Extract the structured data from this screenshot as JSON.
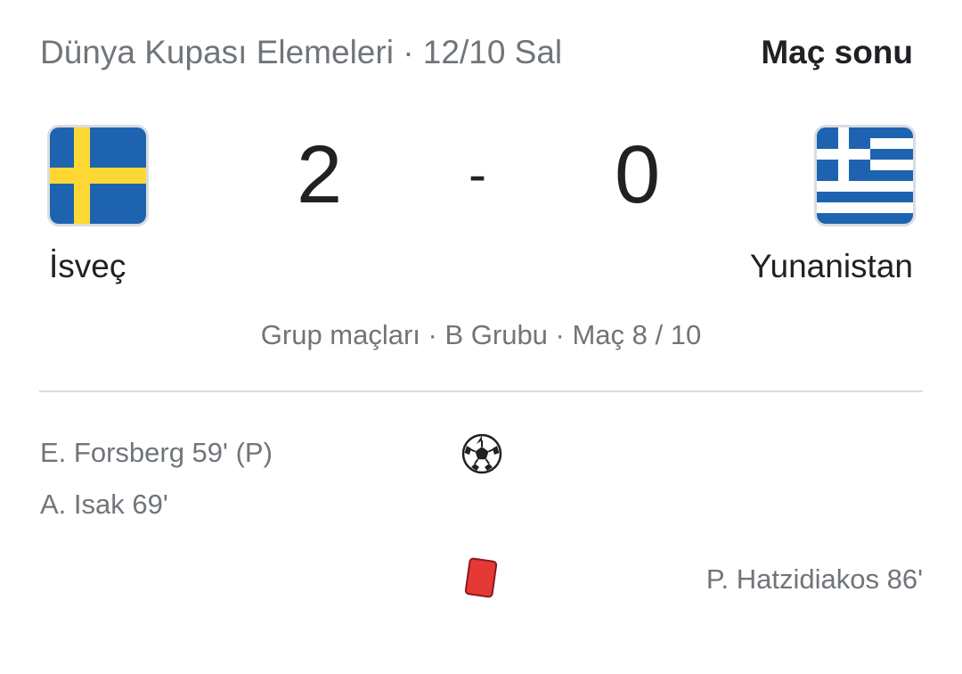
{
  "header": {
    "competition": "Dünya Kupası Elemeleri · 12/10 Sal",
    "status": "Maç sonu"
  },
  "match": {
    "home": {
      "name": "İsveç",
      "score": "2",
      "flag_icon": "sweden-flag-icon",
      "flag_colors": {
        "blue": "#1565c0",
        "yellow": "#fdd835"
      }
    },
    "away": {
      "name": "Yunanistan",
      "score": "0",
      "flag_icon": "greece-flag-icon",
      "flag_colors": {
        "blue": "#1565c0",
        "white": "#ffffff"
      }
    },
    "separator": "-",
    "stage": "Grup maçları · B Grubu · Maç 8 / 10"
  },
  "events": {
    "goals": {
      "icon": "soccer-ball-icon",
      "home": [
        "E. Forsberg 59' (P)",
        "A. Isak 69'"
      ],
      "away": []
    },
    "red_cards": {
      "icon": "red-card-icon",
      "color": "#e53935",
      "home": [],
      "away": [
        "P. Hatzidiakos 86'"
      ]
    }
  }
}
